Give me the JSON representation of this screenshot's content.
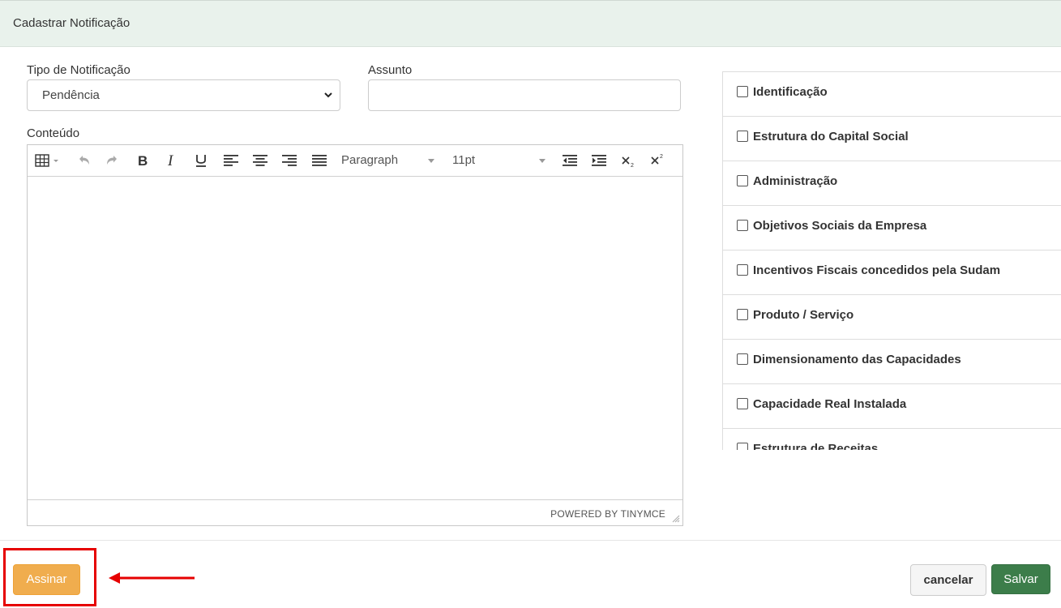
{
  "modal": {
    "title": "Cadastrar Notificação"
  },
  "form": {
    "tipo_label": "Tipo de Notificação",
    "tipo_value": "Pendência",
    "assunto_label": "Assunto",
    "assunto_value": "",
    "conteudo_label": "Conteúdo"
  },
  "editor": {
    "format_select": "Paragraph",
    "size_select": "11pt",
    "powered_by": "POWERED BY TINYMCE"
  },
  "checklist": {
    "items": [
      {
        "label": "Identificação",
        "checked": false
      },
      {
        "label": "Estrutura do Capital Social",
        "checked": false
      },
      {
        "label": "Administração",
        "checked": false
      },
      {
        "label": "Objetivos Sociais da Empresa",
        "checked": false
      },
      {
        "label": "Incentivos Fiscais concedidos pela Sudam",
        "checked": false
      },
      {
        "label": "Produto / Serviço",
        "checked": false
      },
      {
        "label": "Dimensionamento das Capacidades",
        "checked": false
      },
      {
        "label": "Capacidade Real Instalada",
        "checked": false
      },
      {
        "label": "Estrutura de Receitas",
        "checked": false
      }
    ]
  },
  "footer": {
    "assinar_label": "Assinar",
    "cancelar_label": "cancelar",
    "salvar_label": "Salvar"
  },
  "colors": {
    "header_bg": "#e9f2ec",
    "assinar_bg": "#f0ad4e",
    "salvar_bg": "#3c7d4a",
    "highlight": "#e60000"
  }
}
